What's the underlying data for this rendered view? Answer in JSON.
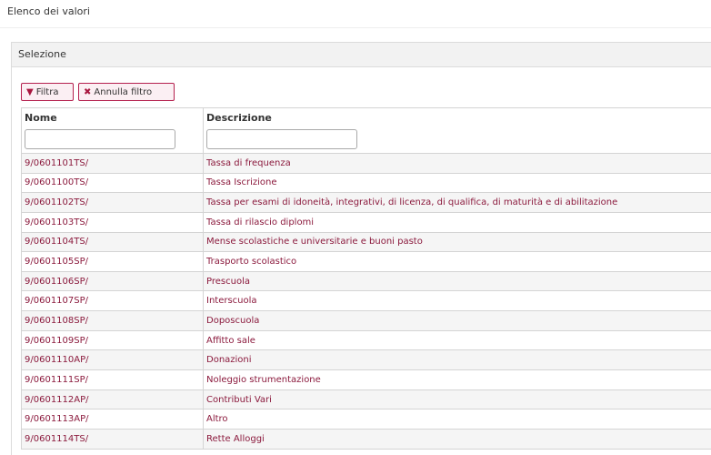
{
  "page": {
    "title": "Elenco dei valori"
  },
  "panel": {
    "heading": "Selezione"
  },
  "toolbar": {
    "filter_icon": "filter-icon",
    "filter_label": "Filtra",
    "clear_icon": "close-icon",
    "clear_label": "Annulla filtro"
  },
  "table": {
    "columns": [
      "Nome",
      "Descrizione"
    ],
    "filters": {
      "nome_value": "",
      "descrizione_value": ""
    },
    "rows": [
      {
        "nome": "9/0601101TS/",
        "descrizione": "Tassa di frequenza"
      },
      {
        "nome": "9/0601100TS/",
        "descrizione": "Tassa Iscrizione"
      },
      {
        "nome": "9/0601102TS/",
        "descrizione": "Tassa per esami di idoneità, integrativi, di licenza, di qualifica, di maturità e di abilitazione"
      },
      {
        "nome": "9/0601103TS/",
        "descrizione": "Tassa di rilascio diplomi"
      },
      {
        "nome": "9/0601104TS/",
        "descrizione": "Mense scolastiche e universitarie e buoni pasto"
      },
      {
        "nome": "9/0601105SP/",
        "descrizione": "Trasporto scolastico"
      },
      {
        "nome": "9/0601106SP/",
        "descrizione": "Prescuola"
      },
      {
        "nome": "9/0601107SP/",
        "descrizione": "Interscuola"
      },
      {
        "nome": "9/0601108SP/",
        "descrizione": "Doposcuola"
      },
      {
        "nome": "9/0601109SP/",
        "descrizione": "Affitto sale"
      },
      {
        "nome": "9/0601110AP/",
        "descrizione": "Donazioni"
      },
      {
        "nome": "9/0601111SP/",
        "descrizione": "Noleggio strumentazione"
      },
      {
        "nome": "9/0601112AP/",
        "descrizione": "Contributi Vari"
      },
      {
        "nome": "9/0601113AP/",
        "descrizione": "Altro"
      },
      {
        "nome": "9/0601114TS/",
        "descrizione": "Rette Alloggi"
      }
    ]
  },
  "colors": {
    "link_text": "#8b1a3d",
    "button_border": "#b5204e",
    "row_alt": "#f5f5f5"
  }
}
